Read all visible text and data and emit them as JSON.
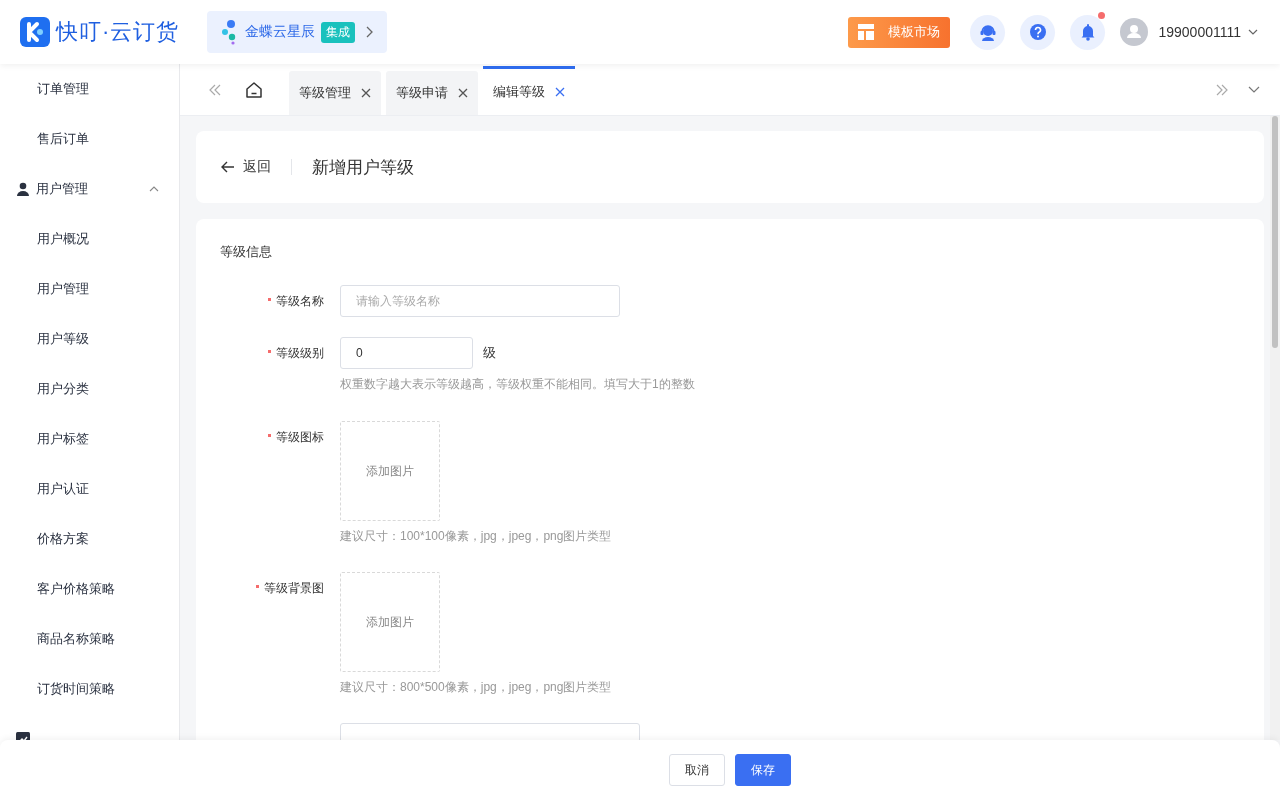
{
  "header": {
    "logo_text": "快叮·云订货",
    "integration": {
      "label": "金蝶云星辰",
      "badge": "集成"
    },
    "market_button": "模板市场",
    "notifications": {
      "unread": true
    },
    "user": "19900001111"
  },
  "sidebar": {
    "items": [
      {
        "label": "订单管理",
        "kind": "item"
      },
      {
        "label": "售后订单",
        "kind": "item"
      },
      {
        "label": "用户管理",
        "kind": "group",
        "expanded": true,
        "children": [
          {
            "label": "用户概况"
          },
          {
            "label": "用户管理"
          },
          {
            "label": "用户等级"
          },
          {
            "label": "用户分类"
          },
          {
            "label": "用户标签"
          },
          {
            "label": "用户认证"
          },
          {
            "label": "价格方案"
          },
          {
            "label": "客户价格策略"
          },
          {
            "label": "商品名称策略"
          },
          {
            "label": "订货时间策略"
          }
        ]
      },
      {
        "kind": "group"
      }
    ]
  },
  "tabs": [
    {
      "label": "等级管理",
      "selected": false
    },
    {
      "label": "等级申请",
      "selected": false
    },
    {
      "label": "编辑等级",
      "selected": true
    }
  ],
  "page_header": {
    "back": "返回",
    "title": "新增用户等级"
  },
  "form": {
    "section": "等级信息",
    "fields": [
      {
        "kind": "input",
        "label": "等级名称",
        "required": true,
        "placeholder": "请输入等级名称"
      },
      {
        "kind": "number",
        "label": "等级级别",
        "required": true,
        "value": "0",
        "suffix": "级",
        "hint": "权重数字越大表示等级越高，等级权重不能相同。填写大于1的整数"
      },
      {
        "kind": "upload",
        "label": "等级图标",
        "required": true,
        "button": "添加图片",
        "hint": "建议尺寸：100*100像素，jpg，jpeg，png图片类型"
      },
      {
        "kind": "upload",
        "label": "等级背景图",
        "required": true,
        "button": "添加图片",
        "hint": "建议尺寸：800*500像素，jpg，jpeg，png图片类型"
      },
      {
        "kind": "textarea"
      }
    ]
  },
  "footer": {
    "buttons": [
      {
        "label": "取消",
        "kind": "default"
      },
      {
        "label": "保存",
        "kind": "primary"
      }
    ]
  }
}
